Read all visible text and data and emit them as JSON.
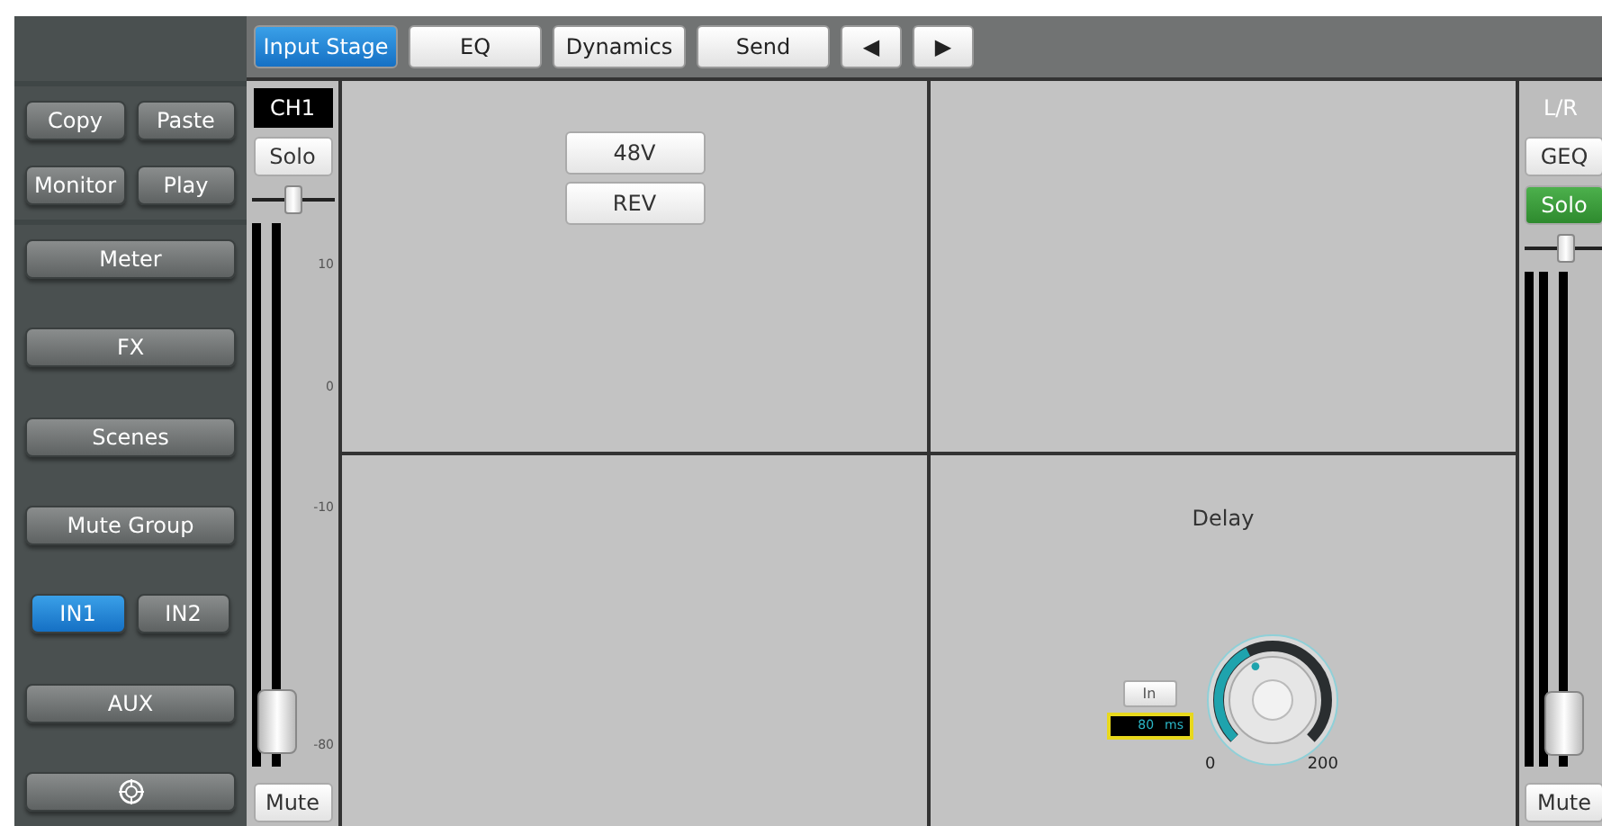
{
  "sidebar": {
    "edit_buttons": [
      {
        "label": "Copy"
      },
      {
        "label": "Paste"
      },
      {
        "label": "Monitor"
      },
      {
        "label": "Play"
      }
    ],
    "nav": [
      {
        "kind": "wide",
        "label": "Meter"
      },
      {
        "kind": "wide",
        "label": "FX"
      },
      {
        "kind": "wide",
        "label": "Scenes"
      },
      {
        "kind": "wide",
        "label": "Mute Group"
      },
      {
        "kind": "pair",
        "items": [
          {
            "label": "IN1",
            "selected": true
          },
          {
            "label": "IN2",
            "selected": false
          }
        ]
      },
      {
        "kind": "wide",
        "label": "AUX"
      },
      {
        "kind": "icon"
      }
    ]
  },
  "tabs": [
    {
      "label": "Input Stage",
      "selected": true
    },
    {
      "label": "EQ",
      "selected": false
    },
    {
      "label": "Dynamics",
      "selected": false
    },
    {
      "label": "Send",
      "selected": false
    }
  ],
  "nav_arrows": [
    "◀",
    "▶"
  ],
  "channel": {
    "name": "CH1",
    "solo": {
      "label": "Solo",
      "on": false
    },
    "pan": {
      "level": 0.5
    },
    "scale": [
      "10",
      "0",
      "-10",
      "-80"
    ],
    "fader": {
      "level": 0.04
    },
    "mute": "Mute"
  },
  "panels": [
    {
      "kind": "buttons",
      "buttons": [
        "48V",
        "REV"
      ]
    },
    {
      "kind": "empty"
    },
    {
      "kind": "empty"
    },
    {
      "kind": "delay",
      "title": "Delay",
      "in_button": "In",
      "readout": "80",
      "unit": "ms",
      "knob": {
        "level": 0.4
      },
      "min": "0",
      "max": "200"
    }
  ],
  "master": {
    "name": "L/R",
    "geq": "GEQ",
    "solo": {
      "label": "Solo",
      "on": true
    },
    "pan": {
      "level": 0.5
    },
    "fader": {
      "level": 0.04
    },
    "mute": "Mute"
  }
}
